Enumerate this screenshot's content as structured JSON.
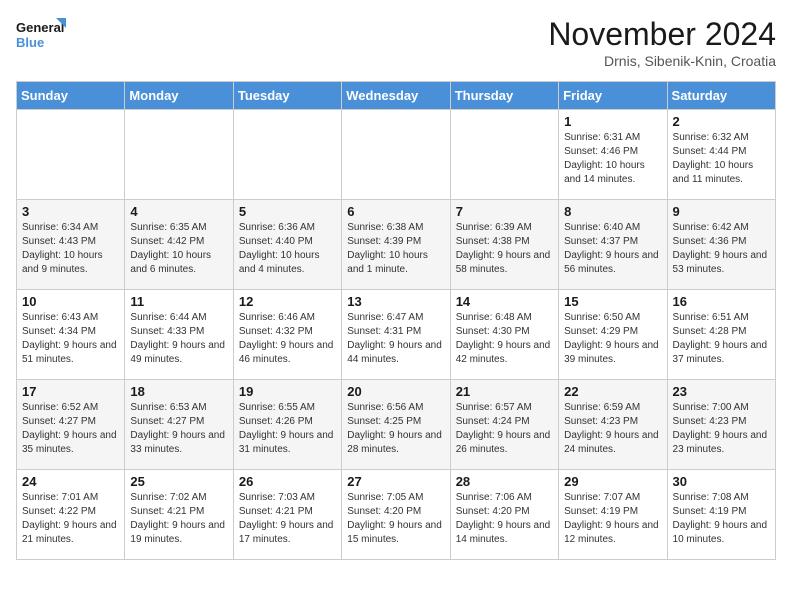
{
  "header": {
    "logo_line1": "General",
    "logo_line2": "Blue",
    "month": "November 2024",
    "location": "Drnis, Sibenik-Knin, Croatia"
  },
  "weekdays": [
    "Sunday",
    "Monday",
    "Tuesday",
    "Wednesday",
    "Thursday",
    "Friday",
    "Saturday"
  ],
  "weeks": [
    [
      {
        "day": "",
        "info": ""
      },
      {
        "day": "",
        "info": ""
      },
      {
        "day": "",
        "info": ""
      },
      {
        "day": "",
        "info": ""
      },
      {
        "day": "",
        "info": ""
      },
      {
        "day": "1",
        "info": "Sunrise: 6:31 AM\nSunset: 4:46 PM\nDaylight: 10 hours and 14 minutes."
      },
      {
        "day": "2",
        "info": "Sunrise: 6:32 AM\nSunset: 4:44 PM\nDaylight: 10 hours and 11 minutes."
      }
    ],
    [
      {
        "day": "3",
        "info": "Sunrise: 6:34 AM\nSunset: 4:43 PM\nDaylight: 10 hours and 9 minutes."
      },
      {
        "day": "4",
        "info": "Sunrise: 6:35 AM\nSunset: 4:42 PM\nDaylight: 10 hours and 6 minutes."
      },
      {
        "day": "5",
        "info": "Sunrise: 6:36 AM\nSunset: 4:40 PM\nDaylight: 10 hours and 4 minutes."
      },
      {
        "day": "6",
        "info": "Sunrise: 6:38 AM\nSunset: 4:39 PM\nDaylight: 10 hours and 1 minute."
      },
      {
        "day": "7",
        "info": "Sunrise: 6:39 AM\nSunset: 4:38 PM\nDaylight: 9 hours and 58 minutes."
      },
      {
        "day": "8",
        "info": "Sunrise: 6:40 AM\nSunset: 4:37 PM\nDaylight: 9 hours and 56 minutes."
      },
      {
        "day": "9",
        "info": "Sunrise: 6:42 AM\nSunset: 4:36 PM\nDaylight: 9 hours and 53 minutes."
      }
    ],
    [
      {
        "day": "10",
        "info": "Sunrise: 6:43 AM\nSunset: 4:34 PM\nDaylight: 9 hours and 51 minutes."
      },
      {
        "day": "11",
        "info": "Sunrise: 6:44 AM\nSunset: 4:33 PM\nDaylight: 9 hours and 49 minutes."
      },
      {
        "day": "12",
        "info": "Sunrise: 6:46 AM\nSunset: 4:32 PM\nDaylight: 9 hours and 46 minutes."
      },
      {
        "day": "13",
        "info": "Sunrise: 6:47 AM\nSunset: 4:31 PM\nDaylight: 9 hours and 44 minutes."
      },
      {
        "day": "14",
        "info": "Sunrise: 6:48 AM\nSunset: 4:30 PM\nDaylight: 9 hours and 42 minutes."
      },
      {
        "day": "15",
        "info": "Sunrise: 6:50 AM\nSunset: 4:29 PM\nDaylight: 9 hours and 39 minutes."
      },
      {
        "day": "16",
        "info": "Sunrise: 6:51 AM\nSunset: 4:28 PM\nDaylight: 9 hours and 37 minutes."
      }
    ],
    [
      {
        "day": "17",
        "info": "Sunrise: 6:52 AM\nSunset: 4:27 PM\nDaylight: 9 hours and 35 minutes."
      },
      {
        "day": "18",
        "info": "Sunrise: 6:53 AM\nSunset: 4:27 PM\nDaylight: 9 hours and 33 minutes."
      },
      {
        "day": "19",
        "info": "Sunrise: 6:55 AM\nSunset: 4:26 PM\nDaylight: 9 hours and 31 minutes."
      },
      {
        "day": "20",
        "info": "Sunrise: 6:56 AM\nSunset: 4:25 PM\nDaylight: 9 hours and 28 minutes."
      },
      {
        "day": "21",
        "info": "Sunrise: 6:57 AM\nSunset: 4:24 PM\nDaylight: 9 hours and 26 minutes."
      },
      {
        "day": "22",
        "info": "Sunrise: 6:59 AM\nSunset: 4:23 PM\nDaylight: 9 hours and 24 minutes."
      },
      {
        "day": "23",
        "info": "Sunrise: 7:00 AM\nSunset: 4:23 PM\nDaylight: 9 hours and 23 minutes."
      }
    ],
    [
      {
        "day": "24",
        "info": "Sunrise: 7:01 AM\nSunset: 4:22 PM\nDaylight: 9 hours and 21 minutes."
      },
      {
        "day": "25",
        "info": "Sunrise: 7:02 AM\nSunset: 4:21 PM\nDaylight: 9 hours and 19 minutes."
      },
      {
        "day": "26",
        "info": "Sunrise: 7:03 AM\nSunset: 4:21 PM\nDaylight: 9 hours and 17 minutes."
      },
      {
        "day": "27",
        "info": "Sunrise: 7:05 AM\nSunset: 4:20 PM\nDaylight: 9 hours and 15 minutes."
      },
      {
        "day": "28",
        "info": "Sunrise: 7:06 AM\nSunset: 4:20 PM\nDaylight: 9 hours and 14 minutes."
      },
      {
        "day": "29",
        "info": "Sunrise: 7:07 AM\nSunset: 4:19 PM\nDaylight: 9 hours and 12 minutes."
      },
      {
        "day": "30",
        "info": "Sunrise: 7:08 AM\nSunset: 4:19 PM\nDaylight: 9 hours and 10 minutes."
      }
    ]
  ]
}
